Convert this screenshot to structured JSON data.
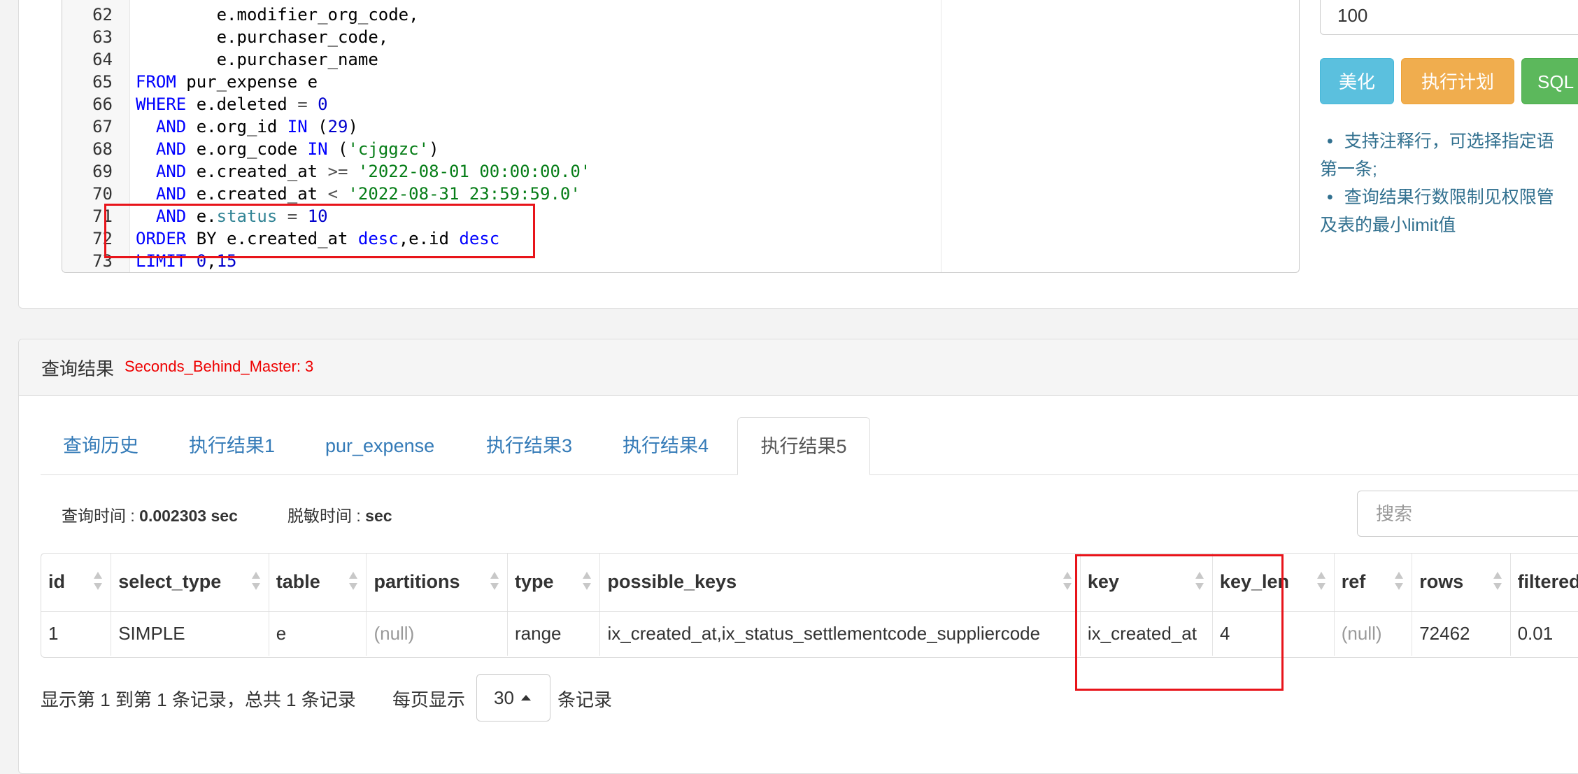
{
  "editor": {
    "lines": [
      {
        "num": "62",
        "parts": [
          {
            "t": "        e.modifier_org_code,",
            "c": "plain"
          }
        ]
      },
      {
        "num": "63",
        "parts": [
          {
            "t": "        e.purchaser_code,",
            "c": "plain"
          }
        ]
      },
      {
        "num": "64",
        "parts": [
          {
            "t": "        e.purchaser_name",
            "c": "plain"
          }
        ]
      },
      {
        "num": "65",
        "parts": [
          {
            "t": "FROM",
            "c": "kw"
          },
          {
            "t": " pur_expense e",
            "c": "plain"
          }
        ]
      },
      {
        "num": "66",
        "parts": [
          {
            "t": "WHERE",
            "c": "kw"
          },
          {
            "t": " e.deleted ",
            "c": "plain"
          },
          {
            "t": "=",
            "c": "op"
          },
          {
            "t": " ",
            "c": "plain"
          },
          {
            "t": "0",
            "c": "num"
          }
        ]
      },
      {
        "num": "67",
        "parts": [
          {
            "t": "  ",
            "c": "plain"
          },
          {
            "t": "AND",
            "c": "kw"
          },
          {
            "t": " e.org_id ",
            "c": "plain"
          },
          {
            "t": "IN",
            "c": "kw"
          },
          {
            "t": " (",
            "c": "plain"
          },
          {
            "t": "29",
            "c": "num"
          },
          {
            "t": ")",
            "c": "plain"
          }
        ]
      },
      {
        "num": "68",
        "parts": [
          {
            "t": "  ",
            "c": "plain"
          },
          {
            "t": "AND",
            "c": "kw"
          },
          {
            "t": " e.org_code ",
            "c": "plain"
          },
          {
            "t": "IN",
            "c": "kw"
          },
          {
            "t": " (",
            "c": "plain"
          },
          {
            "t": "'cjggzc'",
            "c": "str"
          },
          {
            "t": ")",
            "c": "plain"
          }
        ]
      },
      {
        "num": "69",
        "parts": [
          {
            "t": "  ",
            "c": "plain"
          },
          {
            "t": "AND",
            "c": "kw"
          },
          {
            "t": " e.created_at ",
            "c": "plain"
          },
          {
            "t": ">=",
            "c": "op"
          },
          {
            "t": " ",
            "c": "plain"
          },
          {
            "t": "'2022-08-01 00:00:00.0'",
            "c": "str"
          }
        ]
      },
      {
        "num": "70",
        "parts": [
          {
            "t": "  ",
            "c": "plain"
          },
          {
            "t": "AND",
            "c": "kw"
          },
          {
            "t": " e.created_at ",
            "c": "plain"
          },
          {
            "t": "<",
            "c": "op"
          },
          {
            "t": " ",
            "c": "plain"
          },
          {
            "t": "'2022-08-31 23:59:59.0'",
            "c": "str"
          }
        ]
      },
      {
        "num": "71",
        "parts": [
          {
            "t": "  ",
            "c": "plain"
          },
          {
            "t": "AND",
            "c": "kw"
          },
          {
            "t": " e.",
            "c": "plain"
          },
          {
            "t": "status",
            "c": "fld"
          },
          {
            "t": " ",
            "c": "plain"
          },
          {
            "t": "=",
            "c": "op"
          },
          {
            "t": " ",
            "c": "plain"
          },
          {
            "t": "10",
            "c": "num"
          }
        ]
      },
      {
        "num": "72",
        "parts": [
          {
            "t": "ORDER",
            "c": "kw"
          },
          {
            "t": " BY e.created_at ",
            "c": "plain"
          },
          {
            "t": "desc",
            "c": "kw"
          },
          {
            "t": ",e.id ",
            "c": "plain"
          },
          {
            "t": "desc",
            "c": "kw"
          }
        ]
      },
      {
        "num": "73",
        "parts": [
          {
            "t": "LIMIT",
            "c": "kw"
          },
          {
            "t": " ",
            "c": "plain"
          },
          {
            "t": "0",
            "c": "num"
          },
          {
            "t": ",",
            "c": "plain"
          },
          {
            "t": "15",
            "c": "num"
          }
        ]
      }
    ]
  },
  "side": {
    "limit_value": "100",
    "btn_beautify": "美化",
    "btn_explain": "执行计划",
    "btn_sql": "SQL",
    "tip1": "支持注释行，可选择指定语",
    "tip1_cont": "第一条;",
    "tip2": "查询结果行数限制见权限管",
    "tip2_cont": "及表的最小limit值"
  },
  "result": {
    "title": "查询结果",
    "sbm": "Seconds_Behind_Master: 3",
    "tabs": [
      "查询历史",
      "执行结果1",
      "pur_expense",
      "执行结果3",
      "执行结果4"
    ],
    "active_tab": "执行结果5",
    "query_time_label": "查询时间 : ",
    "query_time_value": "0.002303 sec",
    "mask_time_label": "脱敏时间 : ",
    "mask_time_value": "sec",
    "search_placeholder": "搜索"
  },
  "table": {
    "columns": [
      "id",
      "select_type",
      "table",
      "partitions",
      "type",
      "possible_keys",
      "key",
      "key_len",
      "ref",
      "rows",
      "filtered"
    ],
    "row": [
      "1",
      "SIMPLE",
      "e",
      "(null)",
      "range",
      "ix_created_at,ix_status_settlementcode_suppliercode",
      "ix_created_at",
      "4",
      "(null)",
      "72462",
      "0.01"
    ]
  },
  "pager": {
    "summary": "显示第 1 到第 1 条记录，总共 1 条记录",
    "per_page_label": "每页显示",
    "page_size": "30",
    "records_label": "条记录"
  }
}
